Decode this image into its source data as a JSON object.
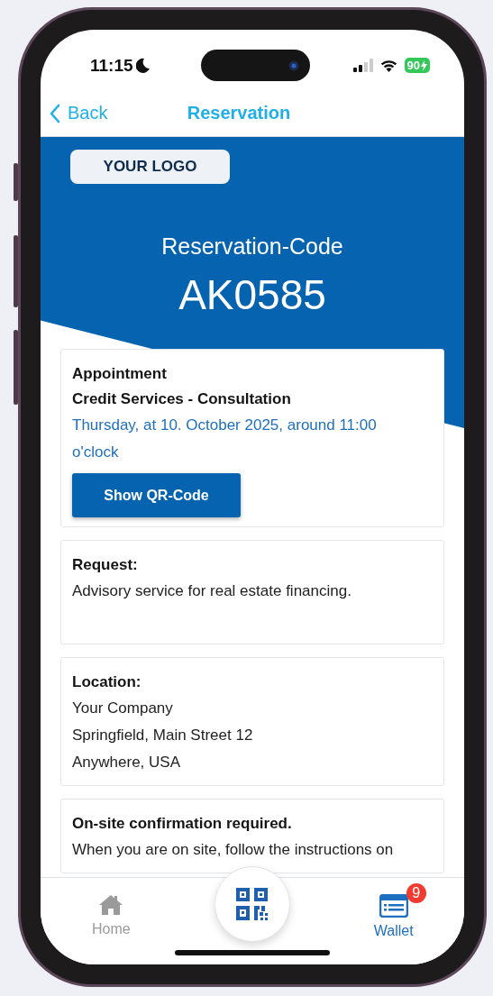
{
  "status_bar": {
    "time": "11:15",
    "battery": "90"
  },
  "nav": {
    "back": "Back",
    "title": "Reservation"
  },
  "logo": "YOUR LOGO",
  "reservation": {
    "label": "Reservation-Code",
    "code": "AK0585"
  },
  "appointment": {
    "heading": "Appointment",
    "service": "Credit Services - Consultation",
    "datetime": "Thursday, at 10. October 2025, around 11:00 o'clock",
    "button": "Show QR-Code"
  },
  "cards": [
    {
      "heading": "Request:",
      "lines": [
        "Advisory service for real estate financing."
      ]
    },
    {
      "heading": "Location:",
      "lines": [
        "Your Company",
        "Springfield, Main Street 12",
        "Anywhere, USA"
      ]
    },
    {
      "heading": "On-site confirmation required.",
      "lines": [
        "When you are on site, follow the instructions on"
      ]
    }
  ],
  "tab_bar": {
    "items": [
      {
        "kind": "home",
        "label": "Home",
        "selected": false
      },
      {
        "kind": "scan"
      },
      {
        "kind": "wallet",
        "label": "Wallet",
        "selected": true,
        "badge": "9"
      }
    ]
  }
}
